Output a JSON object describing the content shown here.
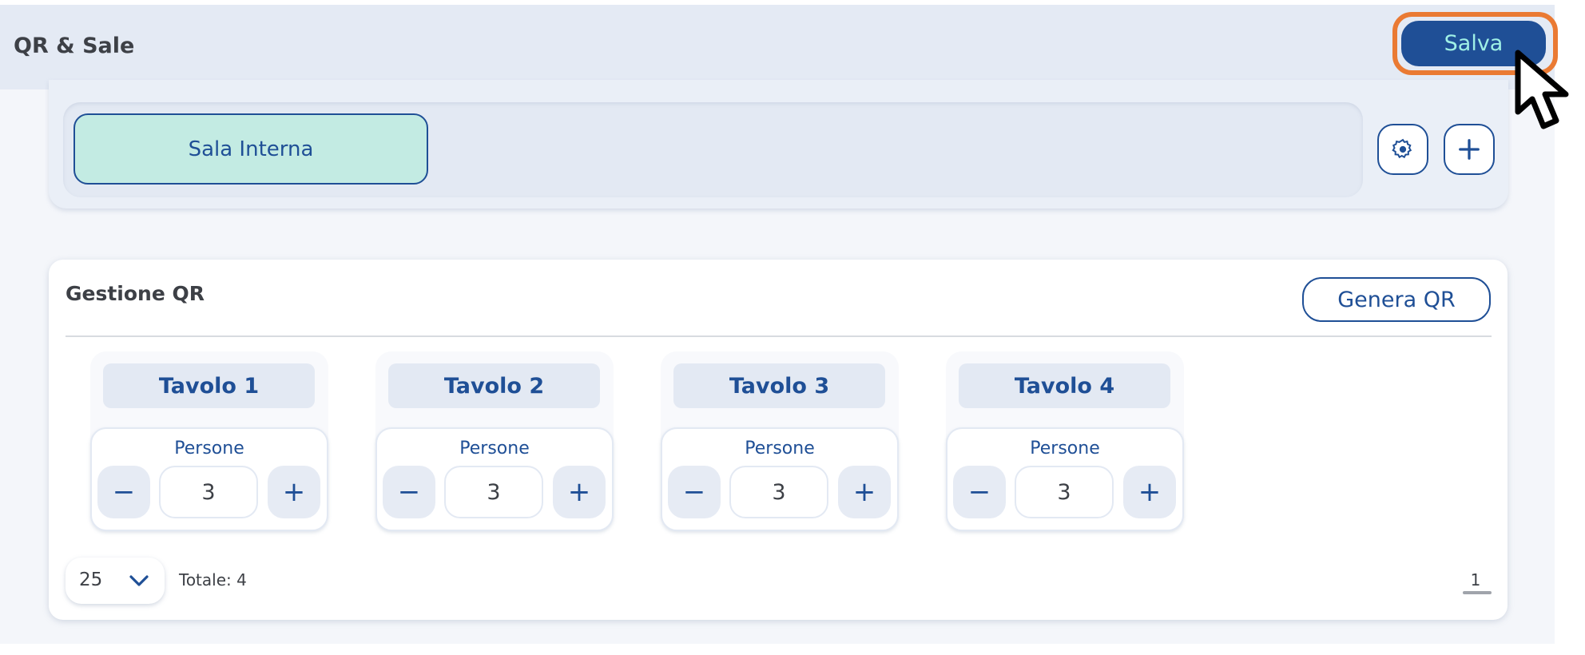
{
  "header": {
    "title": "QR & Sale",
    "save_label": "Salva"
  },
  "rooms": {
    "tabs": [
      {
        "label": "Sala Interna",
        "selected": true
      }
    ],
    "settings_icon": "gear-icon",
    "add_icon": "plus-icon"
  },
  "qr": {
    "title": "Gestione QR",
    "generate_label": "Genera QR",
    "tables": [
      {
        "name": "Tavolo 1",
        "persons_label": "Persone",
        "persons": "3"
      },
      {
        "name": "Tavolo 2",
        "persons_label": "Persone",
        "persons": "3"
      },
      {
        "name": "Tavolo 3",
        "persons_label": "Persone",
        "persons": "3"
      },
      {
        "name": "Tavolo 4",
        "persons_label": "Persone",
        "persons": "3"
      }
    ],
    "stepper": {
      "minus": "−",
      "plus": "+"
    }
  },
  "pagination": {
    "page_size": "25",
    "total_label": "Totale: 4",
    "current_page": "1"
  },
  "colors": {
    "accent": "#1f4f96",
    "highlight": "#ea7a33",
    "selected_tab": "#c3ebe3",
    "save_text": "#9ff0e6"
  }
}
